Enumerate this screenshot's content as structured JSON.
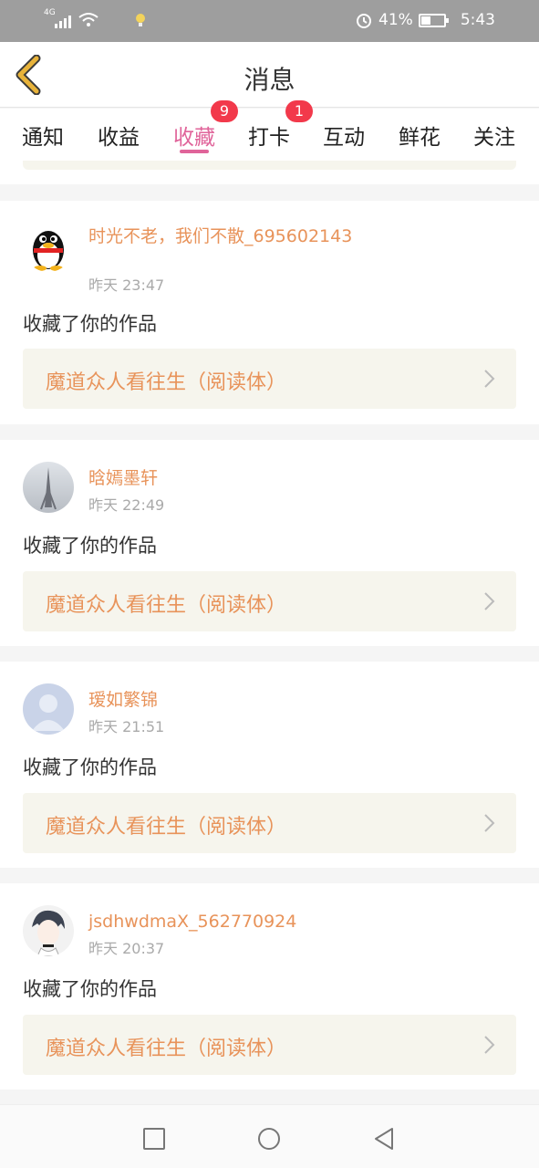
{
  "status_bar": {
    "network_label": "4G",
    "battery_percent": "41%",
    "battery_level": 0.41,
    "time": "5:43",
    "icons": [
      "signal-icon",
      "wifi-icon",
      "bulb-icon",
      "alarm-icon",
      "battery-icon"
    ]
  },
  "header": {
    "title": "消息",
    "back_icon": "chevron-left-icon",
    "accent_color": "#e8b33a"
  },
  "tabs": [
    {
      "label": "通知",
      "badge": ""
    },
    {
      "label": "收益",
      "badge": ""
    },
    {
      "label": "收藏",
      "badge": "9",
      "active": true
    },
    {
      "label": "打卡",
      "badge": "1"
    },
    {
      "label": "互动",
      "badge": ""
    },
    {
      "label": "鲜花",
      "badge": ""
    },
    {
      "label": "关注",
      "badge": ""
    }
  ],
  "colors": {
    "active_tab": "#e0649a",
    "badge": "#f2394b",
    "name_text": "#e8935a",
    "work_bg": "#f6f5ed"
  },
  "feed": [
    {
      "name": "时光不老，我们不散_695602143",
      "time": "昨天 23:47",
      "action": "收藏了你的作品",
      "work_title": "魔道众人看往生（阅读体）",
      "avatar": "penguin-avatar"
    },
    {
      "name": "晗嫣墨轩",
      "time": "昨天 22:49",
      "action": "收藏了你的作品",
      "work_title": "魔道众人看往生（阅读体）",
      "avatar": "tower-photo-avatar"
    },
    {
      "name": "瑷如繁锦",
      "time": "昨天 21:51",
      "action": "收藏了你的作品",
      "work_title": "魔道众人看往生（阅读体）",
      "avatar": "default-avatar"
    },
    {
      "name": "jsdhwdmaX_562770924",
      "time": "昨天 20:37",
      "action": "收藏了你的作品",
      "work_title": "魔道众人看往生（阅读体）",
      "avatar": "anime-avatar"
    }
  ],
  "system_nav": [
    "recent-apps-icon",
    "home-icon",
    "back-triangle-icon"
  ]
}
